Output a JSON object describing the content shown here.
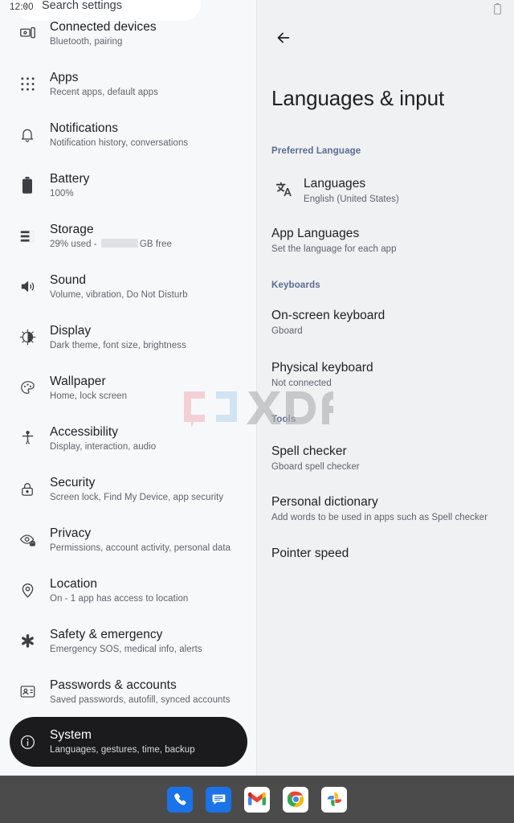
{
  "status_bar": {
    "time": "12:00",
    "battery_icon": "battery-icon"
  },
  "search": {
    "label": "Search settings",
    "back_glyph": "‹"
  },
  "sidebar": {
    "items": [
      {
        "id": "connected-devices",
        "icon": "devices-icon",
        "title": "Connected devices",
        "subtitle": "Bluetooth, pairing"
      },
      {
        "id": "apps",
        "icon": "apps-grid-icon",
        "title": "Apps",
        "subtitle": "Recent apps, default apps"
      },
      {
        "id": "notifications",
        "icon": "bell-icon",
        "title": "Notifications",
        "subtitle": "Notification history, conversations"
      },
      {
        "id": "battery",
        "icon": "battery-icon",
        "title": "Battery",
        "subtitle": "100%"
      },
      {
        "id": "storage",
        "icon": "storage-icon",
        "title": "Storage",
        "subtitle_prefix": "29% used - ",
        "subtitle_redacted": true,
        "subtitle_suffix": "GB free"
      },
      {
        "id": "sound",
        "icon": "volume-icon",
        "title": "Sound",
        "subtitle": "Volume, vibration, Do Not Disturb"
      },
      {
        "id": "display",
        "icon": "brightness-icon",
        "title": "Display",
        "subtitle": "Dark theme, font size, brightness"
      },
      {
        "id": "wallpaper",
        "icon": "palette-icon",
        "title": "Wallpaper",
        "subtitle": "Home, lock screen"
      },
      {
        "id": "accessibility",
        "icon": "accessibility-icon",
        "title": "Accessibility",
        "subtitle": "Display, interaction, audio"
      },
      {
        "id": "security",
        "icon": "lock-icon",
        "title": "Security",
        "subtitle": "Screen lock, Find My Device, app security"
      },
      {
        "id": "privacy",
        "icon": "privacy-eye-icon",
        "title": "Privacy",
        "subtitle": "Permissions, account activity, personal data"
      },
      {
        "id": "location",
        "icon": "location-pin-icon",
        "title": "Location",
        "subtitle": "On - 1 app has access to location"
      },
      {
        "id": "safety-emergency",
        "icon": "asterisk-icon",
        "title": "Safety & emergency",
        "subtitle": "Emergency SOS, medical info, alerts"
      },
      {
        "id": "passwords-accounts",
        "icon": "account-card-icon",
        "title": "Passwords & accounts",
        "subtitle": "Saved passwords, autofill, synced accounts"
      },
      {
        "id": "system",
        "icon": "info-circle-icon",
        "title": "System",
        "subtitle": "Languages, gestures, time, backup",
        "selected": true
      }
    ]
  },
  "detail": {
    "back_icon": "back-arrow-icon",
    "title": "Languages & input",
    "sections": [
      {
        "id": "preferred-language",
        "header": "Preferred Language",
        "items": [
          {
            "id": "languages",
            "icon": "translate-icon",
            "title": "Languages",
            "subtitle": "English (United States)"
          },
          {
            "id": "app-languages",
            "icon": null,
            "title": "App Languages",
            "subtitle": "Set the language for each app"
          }
        ]
      },
      {
        "id": "keyboards",
        "header": "Keyboards",
        "items": [
          {
            "id": "on-screen-keyboard",
            "icon": null,
            "title": "On-screen keyboard",
            "subtitle": "Gboard"
          },
          {
            "id": "physical-keyboard",
            "icon": null,
            "title": "Physical keyboard",
            "subtitle": "Not connected"
          }
        ]
      },
      {
        "id": "tools",
        "header": "Tools",
        "items": [
          {
            "id": "spell-checker",
            "icon": null,
            "title": "Spell checker",
            "subtitle": "Gboard spell checker"
          },
          {
            "id": "personal-dictionary",
            "icon": null,
            "title": "Personal dictionary",
            "subtitle": "Add words to be used in apps such as Spell checker"
          },
          {
            "id": "pointer-speed",
            "icon": null,
            "title": "Pointer speed",
            "subtitle": ""
          }
        ]
      }
    ]
  },
  "watermark": {
    "text": "XDA"
  },
  "taskbar": {
    "apps": [
      {
        "id": "phone",
        "icon": "phone-icon",
        "label": "Phone"
      },
      {
        "id": "messages",
        "icon": "messages-icon",
        "label": "Messages"
      },
      {
        "id": "gmail",
        "icon": "gmail-icon",
        "label": "Gmail"
      },
      {
        "id": "chrome",
        "icon": "chrome-icon",
        "label": "Chrome"
      },
      {
        "id": "photos",
        "icon": "photos-icon",
        "label": "Photos"
      }
    ]
  },
  "colors": {
    "sidebar_bg": "#f7f8fa",
    "detail_bg": "#eff1f3",
    "selected_pill": "#1b1b1d",
    "section_header": "#5a6b93",
    "primary_text": "#202124",
    "secondary_text": "#5f6368",
    "taskbar_bg": "#4b4b4b",
    "accent_blue": "#1a73e8"
  }
}
